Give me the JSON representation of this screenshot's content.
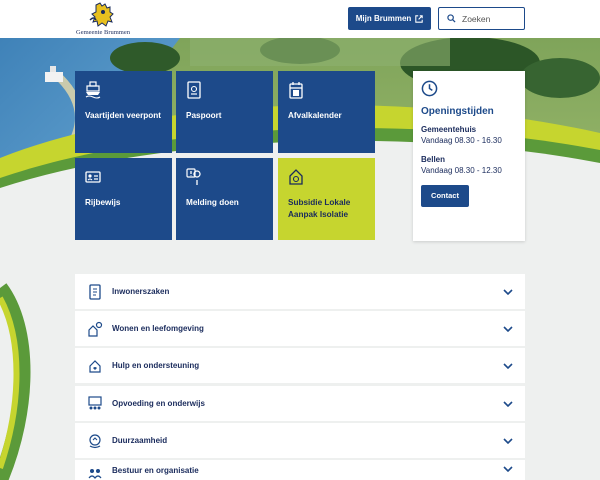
{
  "header": {
    "logo_text": "Gemeente Brummen",
    "mijn_label": "Mijn Brummen",
    "search_placeholder": "Zoeken"
  },
  "tiles": [
    {
      "label": "Vaartijden veerpont",
      "icon": "ferry-icon"
    },
    {
      "label": "Paspoort",
      "icon": "passport-icon"
    },
    {
      "label": "Afvalkalender",
      "icon": "waste-calendar-icon"
    },
    {
      "label": "Rijbewijs",
      "icon": "drivers-license-icon"
    },
    {
      "label": "Melding doen",
      "icon": "report-location-icon"
    },
    {
      "label": "Subsidie Lokale Aanpak Isolatie",
      "icon": "house-money-icon"
    }
  ],
  "opening": {
    "title": "Openingstijden",
    "gemeentehuis_label": "Gemeentehuis",
    "gemeentehuis_hours": "Vandaag 08.30 - 16.30",
    "bellen_label": "Bellen",
    "bellen_hours": "Vandaag 08.30 - 12.30",
    "contact_label": "Contact"
  },
  "accordion": [
    {
      "label": "Inwonerszaken",
      "icon": "citizen-document-icon"
    },
    {
      "label": "Wonen en leefomgeving",
      "icon": "living-environment-icon"
    },
    {
      "label": "Hulp en ondersteuning",
      "icon": "care-house-icon"
    },
    {
      "label": "Opvoeding en onderwijs",
      "icon": "education-board-icon"
    },
    {
      "label": "Duurzaamheid",
      "icon": "sustainability-icon"
    },
    {
      "label": "Bestuur en organisatie",
      "icon": "organisation-icon"
    }
  ],
  "colors": {
    "primary": "#1d4a8a",
    "accent": "#c6d52f",
    "text_dark": "#1a2b5c",
    "background": "#eef0ef"
  }
}
